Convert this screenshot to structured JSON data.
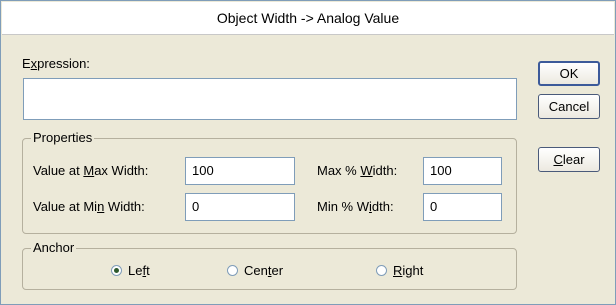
{
  "dialog": {
    "title": "Object Width -> Analog Value"
  },
  "expression": {
    "label_prefix": "E",
    "label_hotkey": "x",
    "label_rest": "pression:",
    "value": ""
  },
  "properties": {
    "legend": "Properties",
    "max_width": {
      "label_pre": "Value at ",
      "label_key": "M",
      "label_post": "ax Width:",
      "value": "100"
    },
    "min_width": {
      "label_pre": "Value at Mi",
      "label_key": "n",
      "label_post": " Width:",
      "value": "0"
    },
    "max_pct": {
      "label_pre": "Max % ",
      "label_key": "W",
      "label_post": "idth:",
      "value": "100"
    },
    "min_pct": {
      "label_pre": "Min % W",
      "label_key": "i",
      "label_post": "dth:",
      "value": "0"
    }
  },
  "anchor": {
    "legend": "Anchor",
    "options": [
      {
        "pre": "Le",
        "key": "f",
        "post": "t",
        "selected": true
      },
      {
        "pre": "Cen",
        "key": "t",
        "post": "er",
        "selected": false
      },
      {
        "pre": "",
        "key": "R",
        "post": "ight",
        "selected": false
      }
    ]
  },
  "buttons": {
    "ok": "OK",
    "cancel": "Cancel",
    "clear_key": "C",
    "clear_rest": "lear"
  }
}
